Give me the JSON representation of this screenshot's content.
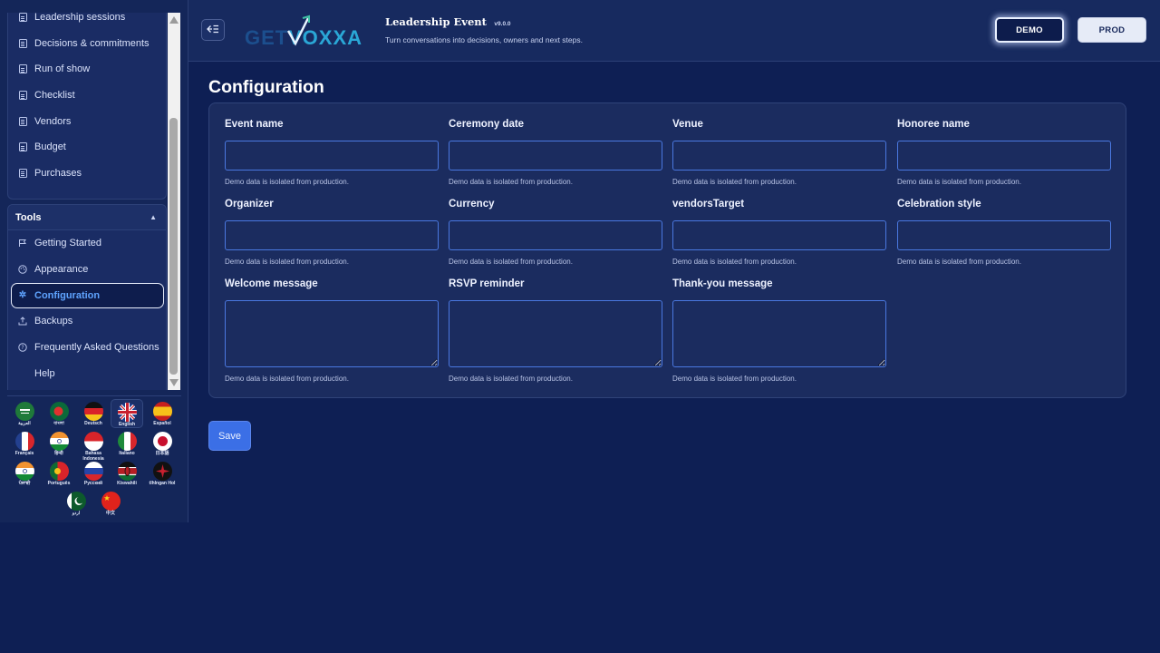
{
  "sidebar": {
    "items": [
      {
        "label": "Leadership sessions",
        "icon": "document-icon"
      },
      {
        "label": "Decisions & commitments",
        "icon": "document-icon"
      },
      {
        "label": "Run of show",
        "icon": "document-icon"
      },
      {
        "label": "Checklist",
        "icon": "document-icon"
      },
      {
        "label": "Vendors",
        "icon": "document-icon"
      },
      {
        "label": "Budget",
        "icon": "document-icon"
      },
      {
        "label": "Purchases",
        "icon": "document-icon"
      }
    ],
    "tools": {
      "heading": "Tools",
      "items": [
        {
          "label": "Getting Started",
          "icon": "flag-icon"
        },
        {
          "label": "Appearance",
          "icon": "palette-icon"
        },
        {
          "label": "Configuration",
          "icon": "gear-icon",
          "active": true
        },
        {
          "label": "Backups",
          "icon": "upload-icon"
        },
        {
          "label": "Frequently Asked Questions",
          "icon": "question-icon"
        },
        {
          "label": "Help",
          "icon": ""
        }
      ]
    },
    "languages": [
      {
        "label": "العربية"
      },
      {
        "label": "বাংলা"
      },
      {
        "label": "Deutsch"
      },
      {
        "label": "English",
        "selected": true
      },
      {
        "label": "Español"
      },
      {
        "label": "Français"
      },
      {
        "label": "हिन्दी"
      },
      {
        "label": "Bahasa Indonesia"
      },
      {
        "label": "Italiano"
      },
      {
        "label": "日本語"
      },
      {
        "label": "ਪੰਜਾਬੀ"
      },
      {
        "label": "Português"
      },
      {
        "label": "Русский"
      },
      {
        "label": "Kiswahili"
      },
      {
        "label": "tlhIngan Hol"
      },
      {
        "label": "اردو"
      },
      {
        "label": "中文"
      }
    ]
  },
  "header": {
    "logo_text": "GETVOXXA",
    "title": "Leadership Event",
    "version": "v9.0.0",
    "tagline": "Turn conversations into decisions, owners and next steps.",
    "demo_label": "DEMO",
    "prod_label": "PROD"
  },
  "main": {
    "title": "Configuration",
    "hint": "Demo data is isolated from production.",
    "fields": [
      {
        "label": "Event name",
        "value": ""
      },
      {
        "label": "Ceremony date",
        "value": ""
      },
      {
        "label": "Venue",
        "value": ""
      },
      {
        "label": "Honoree name",
        "value": ""
      },
      {
        "label": "Organizer",
        "value": ""
      },
      {
        "label": "Currency",
        "value": ""
      },
      {
        "label": "vendorsTarget",
        "value": ""
      },
      {
        "label": "Celebration style",
        "value": ""
      },
      {
        "label": "Welcome message",
        "value": ""
      },
      {
        "label": "RSVP reminder",
        "value": ""
      },
      {
        "label": "Thank-you message",
        "value": ""
      }
    ],
    "save_label": "Save"
  },
  "colors": {
    "background": "#0e1f54",
    "card": "#1b2c5f",
    "accent": "#3b6fe6",
    "active_link": "#5fa4ff",
    "input_border": "#4a78e0"
  }
}
